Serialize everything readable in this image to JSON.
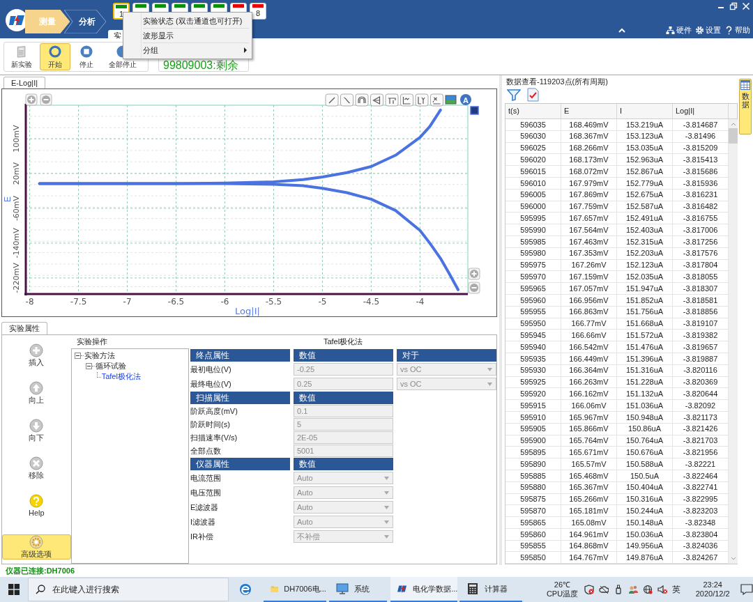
{
  "header": {
    "steps": [
      {
        "label": "测量",
        "selected": true
      },
      {
        "label": "分析",
        "selected": false
      }
    ],
    "channels": [
      {
        "label": "1",
        "selected": true,
        "color": "#0a8f0a"
      },
      {
        "selected": false,
        "color": "#0a8f0a"
      },
      {
        "selected": false,
        "color": "#0a8f0a"
      },
      {
        "selected": false,
        "color": "#0a8f0a"
      },
      {
        "selected": false,
        "color": "#0a8f0a"
      },
      {
        "selected": false,
        "color": "#0a8f0a"
      },
      {
        "selected": false,
        "color": "#e80000"
      },
      {
        "label": "8",
        "selected": false,
        "color": "#e80000"
      }
    ],
    "tab": "实",
    "links": [
      "硬件",
      "设置",
      "帮助"
    ]
  },
  "context_menu": [
    {
      "label": "实验状态 (双击通道也可打开)",
      "submenu": false
    },
    {
      "label": "波形显示",
      "submenu": false
    },
    {
      "label": "分组",
      "submenu": true
    }
  ],
  "toolbar": {
    "buttons": [
      {
        "label": "新实验",
        "selected": false
      },
      {
        "label": "开始",
        "selected": true
      },
      {
        "label": "停止",
        "selected": false
      },
      {
        "label": "全部停止",
        "selected": false
      }
    ],
    "remaining": "99809003:剩余"
  },
  "chart_panel": {
    "tab": "E-Log|I|",
    "auto_button": "A",
    "chart_data": {
      "type": "line",
      "grid": true,
      "xlabel": "Log|I|",
      "ylabel": "E",
      "x": [
        -7.9,
        -7.5,
        -7,
        -6.5,
        -6,
        -5.5,
        -5.2,
        -5,
        -4.75,
        -4.5,
        -4.25,
        -4,
        -3.9,
        -3.79,
        -3.7,
        -3.61
      ],
      "series": [
        {
          "color": "#4a72e0",
          "values": [
            -3,
            -3,
            -3,
            -3,
            -2,
            1,
            6,
            12,
            22,
            36,
            62,
            103,
            128,
            166,
            null,
            null
          ]
        },
        {
          "color": "#4a72e0",
          "values": [
            -3,
            -3,
            -3,
            -3,
            -3,
            -5,
            -8,
            -14,
            -24,
            -39,
            -65,
            -111,
            -140,
            -175,
            -210,
            -247
          ]
        }
      ],
      "xlim": [
        -8.04,
        -3.51
      ],
      "ylim": [
        -257,
        177
      ],
      "xticks": [
        -8,
        -7.5,
        -7,
        -6.5,
        -6,
        -5.5,
        -5,
        -4.5,
        -4
      ],
      "yticks": [
        {
          "value": 100,
          "label": "100mV"
        },
        {
          "value": 20,
          "label": "20mV"
        },
        {
          "value": -60,
          "label": "-60mV"
        },
        {
          "value": -140,
          "label": "-140mV"
        },
        {
          "value": -220,
          "label": "-220mV"
        }
      ]
    }
  },
  "properties": {
    "tab": "实验属性",
    "actions": [
      {
        "label": "插入",
        "selected": false
      },
      {
        "label": "向上",
        "selected": false
      },
      {
        "label": "向下",
        "selected": false
      },
      {
        "label": "移除",
        "selected": false
      },
      {
        "label": "Help",
        "selected": false
      },
      {
        "label": "高级选项",
        "selected": true
      }
    ],
    "tree_title": "实验操作",
    "tree": [
      {
        "label": "实验方法",
        "expanded": true,
        "selected": false,
        "children": [
          {
            "label": "循环试验",
            "expanded": true,
            "selected": false,
            "children": [
              {
                "label": "Tafel极化法",
                "selected": true
              }
            ]
          }
        ]
      }
    ],
    "form_title": "Tafel极化法",
    "sections": [
      {
        "headers": [
          "终点属性",
          "数值",
          "对于"
        ],
        "rows": [
          {
            "label": "最初电位(V)",
            "kind": "text",
            "value": "-0.25",
            "disabled": true,
            "reference": "vs OC"
          },
          {
            "label": "最终电位(V)",
            "kind": "text",
            "value": "0.25",
            "disabled": true,
            "reference": "vs OC"
          }
        ]
      },
      {
        "headers": [
          "扫描属性",
          "数值"
        ],
        "rows": [
          {
            "label": "阶跃高度(mV)",
            "kind": "text",
            "value": "0.1",
            "disabled": true
          },
          {
            "label": "阶跃时间(s)",
            "kind": "text",
            "value": "5",
            "disabled": true
          },
          {
            "label": "扫描速率(V/s)",
            "kind": "text",
            "value": "2E-05",
            "disabled": true
          },
          {
            "label": "全部点数",
            "kind": "text",
            "value": "5001",
            "disabled": true
          }
        ]
      },
      {
        "headers": [
          "仪器属性",
          "数值"
        ],
        "rows": [
          {
            "label": "电流范围",
            "kind": "select",
            "value": "Auto",
            "disabled": true
          },
          {
            "label": "电压范围",
            "kind": "select",
            "value": "Auto",
            "disabled": true
          },
          {
            "label": "E滤波器",
            "kind": "select",
            "value": "Auto",
            "disabled": true
          },
          {
            "label": "I滤波器",
            "kind": "select",
            "value": "Auto",
            "disabled": true
          },
          {
            "label": "IR补偿",
            "kind": "select",
            "value": "不补偿",
            "disabled": true
          }
        ]
      }
    ]
  },
  "data_view": {
    "title": "数据查看-119203点(所有周期)",
    "side_tab": "数据",
    "columns": [
      "t(s)",
      "E",
      "I",
      "Log|I|"
    ],
    "rows": [
      [
        "596035",
        "168.469mV",
        "153.219uA",
        "-3.814687"
      ],
      [
        "596030",
        "168.367mV",
        "153.123uA",
        "-3.81496"
      ],
      [
        "596025",
        "168.266mV",
        "153.035uA",
        "-3.815209"
      ],
      [
        "596020",
        "168.173mV",
        "152.963uA",
        "-3.815413"
      ],
      [
        "596015",
        "168.072mV",
        "152.867uA",
        "-3.815686"
      ],
      [
        "596010",
        "167.979mV",
        "152.779uA",
        "-3.815936"
      ],
      [
        "596005",
        "167.869mV",
        "152.675uA",
        "-3.816231"
      ],
      [
        "596000",
        "167.759mV",
        "152.587uA",
        "-3.816482"
      ],
      [
        "595995",
        "167.657mV",
        "152.491uA",
        "-3.816755"
      ],
      [
        "595990",
        "167.564mV",
        "152.403uA",
        "-3.817006"
      ],
      [
        "595985",
        "167.463mV",
        "152.315uA",
        "-3.817256"
      ],
      [
        "595980",
        "167.353mV",
        "152.203uA",
        "-3.817576"
      ],
      [
        "595975",
        "167.26mV",
        "152.123uA",
        "-3.817804"
      ],
      [
        "595970",
        "167.159mV",
        "152.035uA",
        "-3.818055"
      ],
      [
        "595965",
        "167.057mV",
        "151.947uA",
        "-3.818307"
      ],
      [
        "595960",
        "166.956mV",
        "151.852uA",
        "-3.818581"
      ],
      [
        "595955",
        "166.863mV",
        "151.756uA",
        "-3.818856"
      ],
      [
        "595950",
        "166.77mV",
        "151.668uA",
        "-3.819107"
      ],
      [
        "595945",
        "166.66mV",
        "151.572uA",
        "-3.819382"
      ],
      [
        "595940",
        "166.542mV",
        "151.476uA",
        "-3.819657"
      ],
      [
        "595935",
        "166.449mV",
        "151.396uA",
        "-3.819887"
      ],
      [
        "595930",
        "166.364mV",
        "151.316uA",
        "-3.820116"
      ],
      [
        "595925",
        "166.263mV",
        "151.228uA",
        "-3.820369"
      ],
      [
        "595920",
        "166.162mV",
        "151.132uA",
        "-3.820644"
      ],
      [
        "595915",
        "166.06mV",
        "151.036uA",
        "-3.82092"
      ],
      [
        "595910",
        "165.967mV",
        "150.948uA",
        "-3.821173"
      ],
      [
        "595905",
        "165.866mV",
        "150.86uA",
        "-3.821426"
      ],
      [
        "595900",
        "165.764mV",
        "150.764uA",
        "-3.821703"
      ],
      [
        "595895",
        "165.671mV",
        "150.676uA",
        "-3.821956"
      ],
      [
        "595890",
        "165.57mV",
        "150.588uA",
        "-3.82221"
      ],
      [
        "595885",
        "165.468mV",
        "150.5uA",
        "-3.822464"
      ],
      [
        "595880",
        "165.367mV",
        "150.404uA",
        "-3.822741"
      ],
      [
        "595875",
        "165.266mV",
        "150.316uA",
        "-3.822995"
      ],
      [
        "595870",
        "165.181mV",
        "150.244uA",
        "-3.823203"
      ],
      [
        "595865",
        "165.08mV",
        "150.148uA",
        "-3.82348"
      ],
      [
        "595860",
        "164.961mV",
        "150.036uA",
        "-3.823804"
      ],
      [
        "595855",
        "164.868mV",
        "149.956uA",
        "-3.824036"
      ],
      [
        "595850",
        "164.767mV",
        "149.876uA",
        "-3.824267"
      ]
    ]
  },
  "status_bar": "仪器已连接:DH7006",
  "taskbar": {
    "search_placeholder": "在此键入进行搜索",
    "apps": [
      {
        "label": "DH7006电...",
        "selected": false
      },
      {
        "label": "系统",
        "selected": false
      },
      {
        "label": "电化学数据...",
        "selected": true
      },
      {
        "label": "计算器",
        "selected": false
      }
    ],
    "temperature": "26℃",
    "sensor": "CPU温度",
    "ime": "英",
    "time": "23:24",
    "date": "2020/12/2"
  }
}
